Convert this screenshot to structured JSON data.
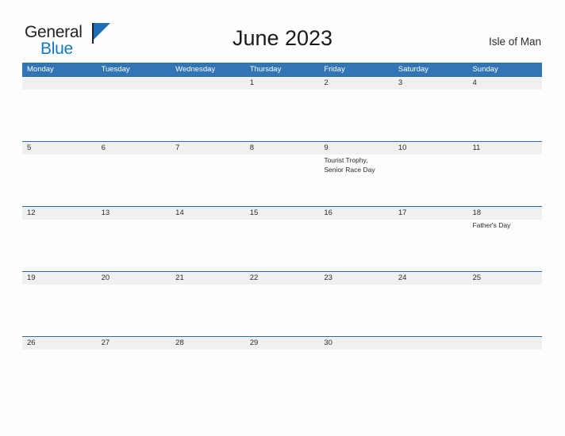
{
  "brand": {
    "word_one": "General",
    "word_two": "Blue",
    "flag_icon": "flag-triangle-icon",
    "accent_blue": "#1379c4",
    "dark": "#231f20"
  },
  "header": {
    "title": "June 2023",
    "locale": "Isle of Man"
  },
  "colors": {
    "header_band": "#3175b4",
    "week_rule": "#2a6ca8",
    "number_band": "#f0f0f0",
    "page_bg": "#fdfdfd",
    "text": "#2b2b2b"
  },
  "calendar": {
    "day_headers": [
      "Monday",
      "Tuesday",
      "Wednesday",
      "Thursday",
      "Friday",
      "Saturday",
      "Sunday"
    ],
    "weeks": [
      {
        "days": [
          {
            "number": "",
            "event": ""
          },
          {
            "number": "",
            "event": ""
          },
          {
            "number": "",
            "event": ""
          },
          {
            "number": "1",
            "event": ""
          },
          {
            "number": "2",
            "event": ""
          },
          {
            "number": "3",
            "event": ""
          },
          {
            "number": "4",
            "event": ""
          }
        ]
      },
      {
        "days": [
          {
            "number": "5",
            "event": ""
          },
          {
            "number": "6",
            "event": ""
          },
          {
            "number": "7",
            "event": ""
          },
          {
            "number": "8",
            "event": ""
          },
          {
            "number": "9",
            "event": "Tourist Trophy,\nSenior Race Day"
          },
          {
            "number": "10",
            "event": ""
          },
          {
            "number": "11",
            "event": ""
          }
        ]
      },
      {
        "days": [
          {
            "number": "12",
            "event": ""
          },
          {
            "number": "13",
            "event": ""
          },
          {
            "number": "14",
            "event": ""
          },
          {
            "number": "15",
            "event": ""
          },
          {
            "number": "16",
            "event": ""
          },
          {
            "number": "17",
            "event": ""
          },
          {
            "number": "18",
            "event": "Father's Day"
          }
        ]
      },
      {
        "days": [
          {
            "number": "19",
            "event": ""
          },
          {
            "number": "20",
            "event": ""
          },
          {
            "number": "21",
            "event": ""
          },
          {
            "number": "22",
            "event": ""
          },
          {
            "number": "23",
            "event": ""
          },
          {
            "number": "24",
            "event": ""
          },
          {
            "number": "25",
            "event": ""
          }
        ]
      },
      {
        "days": [
          {
            "number": "26",
            "event": ""
          },
          {
            "number": "27",
            "event": ""
          },
          {
            "number": "28",
            "event": ""
          },
          {
            "number": "29",
            "event": ""
          },
          {
            "number": "30",
            "event": ""
          },
          {
            "number": "",
            "event": ""
          },
          {
            "number": "",
            "event": ""
          }
        ]
      }
    ]
  }
}
